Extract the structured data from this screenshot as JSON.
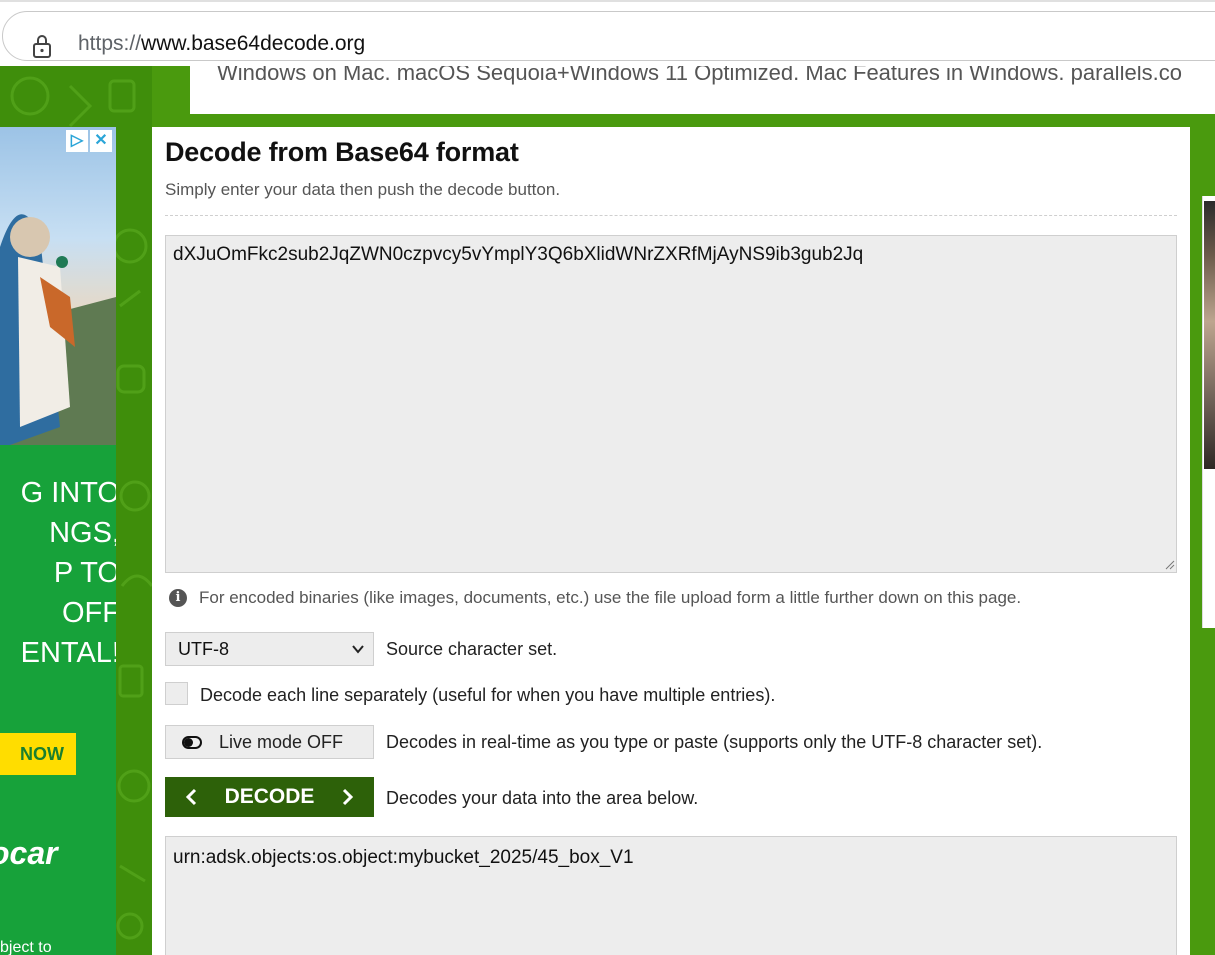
{
  "browser": {
    "url_scheme": "https://",
    "url_host": "www.base64decode.org"
  },
  "top_ad": {
    "text": "Windows on Mac. macOS Sequoia+Windows 11 Optimized. Mac Features in Windows. parallels.co"
  },
  "left_ad": {
    "headline": [
      "G INTO",
      "NGS,",
      "P TO",
      "OFF",
      "ENTAL!"
    ],
    "cta": "NOW",
    "brand": "ocar",
    "footer": "bject to"
  },
  "main": {
    "title": "Decode from Base64 format",
    "subtitle": "Simply enter your data then push the decode button.",
    "input_value": "dXJuOmFkc2sub2JqZWN0czpvcy5vYmplY3Q6bXlidWNrZXRfMjAyNS9ib3gub2Jq",
    "info_text": "For encoded binaries (like images, documents, etc.) use the file upload form a little further down on this page.",
    "charset_value": "UTF-8",
    "charset_label": "Source character set.",
    "checkbox_label": "Decode each line separately (useful for when you have multiple entries).",
    "live_mode_label": "Live mode OFF",
    "live_mode_desc": "Decodes in real-time as you type or paste (supports only the UTF-8 character set).",
    "decode_label": "DECODE",
    "decode_desc": "Decodes your data into the area below.",
    "output_value": "urn:adsk.objects:os.object:mybucket_2025/45_box_V1"
  }
}
